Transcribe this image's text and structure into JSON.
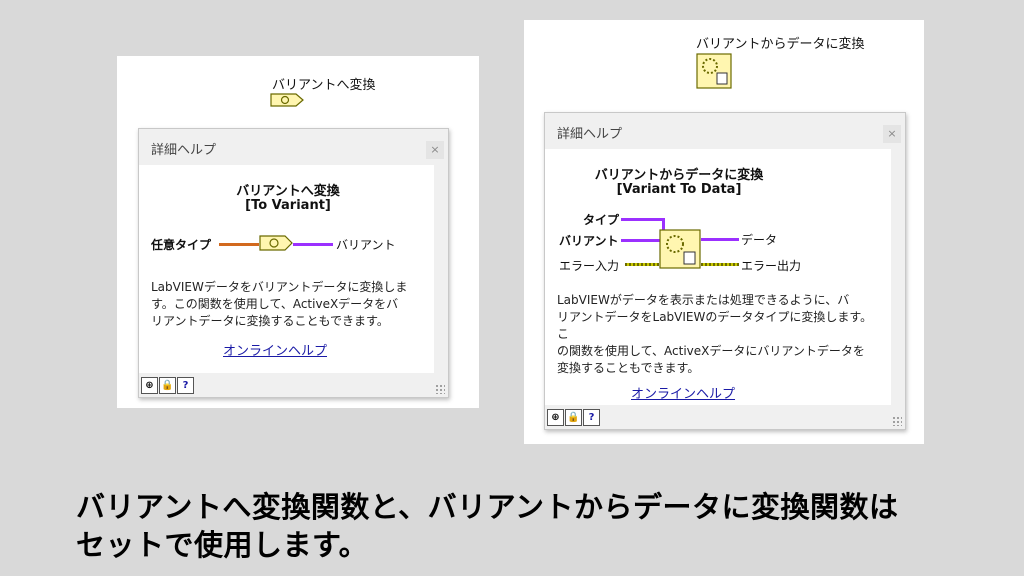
{
  "left": {
    "node_title": "バリアントへ変換",
    "help": {
      "window_title": "詳細ヘルプ",
      "close_glyph": "×",
      "function_name_jp": "バリアントへ変換",
      "function_name_en": "[To Variant]",
      "input_label": "任意タイプ",
      "output_label": "バリアント",
      "description_lines": [
        "LabVIEWデータをバリアントデータに変換しま",
        "す。この関数を使用して、ActiveXデータをバ",
        "リアントデータに変換することもできます。"
      ],
      "link": "オンラインヘルプ"
    }
  },
  "right": {
    "node_title": "バリアントからデータに変換",
    "help": {
      "window_title": "詳細ヘルプ",
      "close_glyph": "×",
      "function_name_jp": "バリアントからデータに変換",
      "function_name_en": "[Variant To Data]",
      "inputs": [
        "タイプ",
        "バリアント",
        "エラー入力"
      ],
      "outputs": [
        "データ",
        "エラー出力"
      ],
      "description_lines": [
        "LabVIEWがデータを表示または処理できるように、バ",
        "リアントデータをLabVIEWのデータタイプに変換します。こ",
        "の関数を使用して、ActiveXデータにバリアントデータを",
        "変換することもできます。"
      ],
      "link": "オンラインヘルプ"
    }
  },
  "footer_buttons": [
    "?"
  ],
  "caption_lines": [
    "バリアントへ変換関数と、バリアントからデータに変換関数は",
    "セットで使用します。"
  ]
}
